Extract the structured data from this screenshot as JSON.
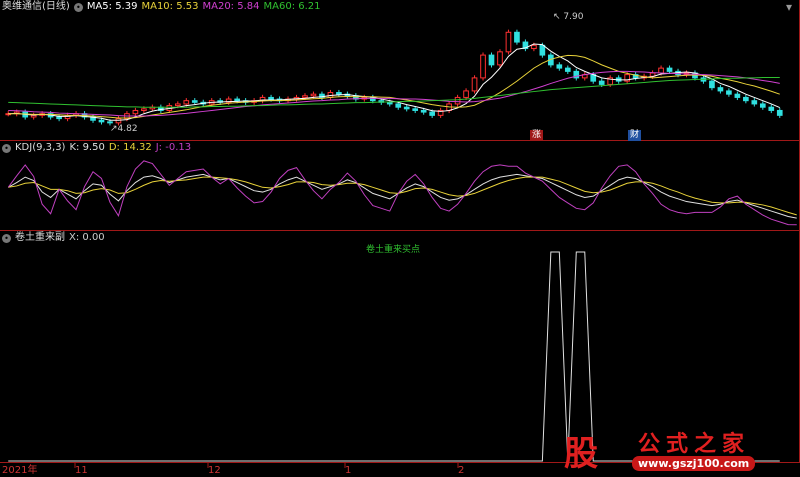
{
  "panel_main": {
    "stock_name": "奥维通信(日线)",
    "ma": [
      {
        "label": "MA5: 5.39",
        "color": "#ffffff"
      },
      {
        "label": "MA10: 5.53",
        "color": "#e8d23a"
      },
      {
        "label": "MA20: 5.84",
        "color": "#d040d0"
      },
      {
        "label": "MA60: 6.21",
        "color": "#30c030"
      }
    ],
    "high_label": "7.90",
    "low_label": "4.82",
    "stamp_up": "涨",
    "stamp_fin": "财"
  },
  "panel_kdj": {
    "name": "KDJ(9,3,3)",
    "k": "K: 9.50",
    "d": "D: 14.32",
    "j": "J: -0.13",
    "colors": {
      "k": "#e0e0e0",
      "d": "#e8d23a",
      "j": "#c040c0"
    }
  },
  "panel_ind": {
    "name": "卷土重来副",
    "x": "X: 0.00",
    "signal_label": "卷土重来买点",
    "colors": {
      "line": "#e0e0e0",
      "signal": "#30c030"
    }
  },
  "x_axis": [
    "2021年",
    "11",
    "12",
    "1",
    "2"
  ],
  "logo": {
    "gu": "股",
    "name": "公式之家",
    "url": "www.gszj100.com"
  },
  "chart_data": [
    {
      "type": "candlestick",
      "title": "奥维通信(日线)",
      "x": [
        "2021年",
        "11",
        "12",
        "1",
        "2"
      ],
      "close": [
        5.1,
        5.15,
        5.0,
        5.05,
        5.1,
        5.0,
        4.95,
        5.05,
        5.1,
        5.0,
        4.9,
        4.85,
        4.82,
        4.95,
        5.1,
        5.2,
        5.25,
        5.3,
        5.2,
        5.35,
        5.4,
        5.5,
        5.45,
        5.4,
        5.5,
        5.45,
        5.55,
        5.5,
        5.45,
        5.5,
        5.6,
        5.55,
        5.5,
        5.55,
        5.6,
        5.65,
        5.7,
        5.6,
        5.75,
        5.7,
        5.65,
        5.55,
        5.6,
        5.5,
        5.45,
        5.4,
        5.3,
        5.25,
        5.2,
        5.15,
        5.05,
        5.2,
        5.4,
        5.6,
        5.8,
        6.2,
        6.9,
        6.6,
        7.0,
        7.6,
        7.3,
        7.1,
        7.2,
        6.9,
        6.6,
        6.5,
        6.4,
        6.2,
        6.3,
        6.1,
        6.0,
        6.2,
        6.1,
        6.3,
        6.2,
        6.25,
        6.35,
        6.5,
        6.4,
        6.3,
        6.35,
        6.2,
        6.1,
        5.9,
        5.8,
        5.7,
        5.6,
        5.5,
        5.4,
        5.3,
        5.2,
        5.05
      ],
      "high_marker": 7.9,
      "low_marker": 4.82,
      "series": [
        {
          "name": "MA5",
          "values": [
            5.1,
            5.11,
            5.08,
            5.06,
            5.08,
            5.06,
            5.02,
            5.02,
            5.04,
            5.02,
            4.99,
            4.96,
            4.9,
            4.9,
            4.92,
            5.0,
            5.1,
            5.18,
            5.23,
            5.26,
            5.3,
            5.35,
            5.38,
            5.42,
            5.45,
            5.46,
            5.47,
            5.48,
            5.49,
            5.49,
            5.52,
            5.52,
            5.52,
            5.54,
            5.56,
            5.57,
            5.6,
            5.62,
            5.66,
            5.68,
            5.69,
            5.65,
            5.63,
            5.6,
            5.55,
            5.5,
            5.45,
            5.38,
            5.32,
            5.26,
            5.19,
            5.17,
            5.2,
            5.28,
            5.41,
            5.64,
            6.0,
            6.22,
            6.5,
            6.86,
            7.08,
            7.12,
            7.24,
            7.22,
            7.02,
            6.86,
            6.72,
            6.52,
            6.4,
            6.3,
            6.2,
            6.16,
            6.14,
            6.14,
            6.18,
            6.21,
            6.24,
            6.32,
            6.34,
            6.36,
            6.38,
            6.35,
            6.27,
            6.17,
            6.03,
            5.94,
            5.82,
            5.7,
            5.6,
            5.5,
            5.4,
            5.29
          ]
        },
        {
          "name": "MA10",
          "values": [
            5.1,
            5.1,
            5.09,
            5.08,
            5.08,
            5.08,
            5.07,
            5.05,
            5.05,
            5.04,
            5.03,
            5.01,
            4.99,
            4.97,
            4.97,
            4.98,
            5.02,
            5.06,
            5.1,
            5.14,
            5.18,
            5.22,
            5.27,
            5.32,
            5.36,
            5.39,
            5.42,
            5.44,
            5.46,
            5.47,
            5.49,
            5.5,
            5.5,
            5.51,
            5.52,
            5.54,
            5.56,
            5.57,
            5.6,
            5.62,
            5.63,
            5.62,
            5.62,
            5.62,
            5.61,
            5.6,
            5.56,
            5.52,
            5.48,
            5.43,
            5.38,
            5.34,
            5.31,
            5.3,
            5.31,
            5.36,
            5.48,
            5.6,
            5.75,
            5.92,
            6.1,
            6.3,
            6.5,
            6.65,
            6.77,
            6.84,
            6.89,
            6.88,
            6.83,
            6.72,
            6.6,
            6.5,
            6.4,
            6.34,
            6.28,
            6.23,
            6.2,
            6.22,
            6.24,
            6.26,
            6.28,
            6.29,
            6.28,
            6.25,
            6.19,
            6.14,
            6.08,
            6.01,
            5.95,
            5.87,
            5.79,
            5.7
          ]
        },
        {
          "name": "MA20",
          "values": [
            5.2,
            5.19,
            5.18,
            5.16,
            5.15,
            5.14,
            5.12,
            5.11,
            5.1,
            5.09,
            5.08,
            5.07,
            5.06,
            5.04,
            5.03,
            5.03,
            5.03,
            5.04,
            5.05,
            5.07,
            5.09,
            5.11,
            5.14,
            5.17,
            5.2,
            5.23,
            5.26,
            5.29,
            5.32,
            5.34,
            5.37,
            5.39,
            5.41,
            5.43,
            5.45,
            5.47,
            5.49,
            5.5,
            5.52,
            5.53,
            5.55,
            5.56,
            5.57,
            5.57,
            5.57,
            5.57,
            5.56,
            5.55,
            5.55,
            5.54,
            5.52,
            5.5,
            5.48,
            5.47,
            5.46,
            5.47,
            5.5,
            5.54,
            5.58,
            5.64,
            5.71,
            5.78,
            5.86,
            5.94,
            6.03,
            6.11,
            6.19,
            6.25,
            6.3,
            6.34,
            6.37,
            6.39,
            6.4,
            6.4,
            6.39,
            6.38,
            6.36,
            6.35,
            6.34,
            6.33,
            6.32,
            6.31,
            6.3,
            6.29,
            6.27,
            6.25,
            6.23,
            6.2,
            6.16,
            6.12,
            6.08,
            6.03
          ]
        },
        {
          "name": "MA60",
          "values": [
            5.45,
            5.44,
            5.43,
            5.42,
            5.41,
            5.4,
            5.39,
            5.38,
            5.37,
            5.36,
            5.35,
            5.34,
            5.33,
            5.32,
            5.31,
            5.31,
            5.3,
            5.3,
            5.3,
            5.3,
            5.3,
            5.3,
            5.31,
            5.31,
            5.32,
            5.32,
            5.33,
            5.33,
            5.34,
            5.35,
            5.35,
            5.36,
            5.37,
            5.37,
            5.38,
            5.39,
            5.4,
            5.4,
            5.41,
            5.42,
            5.43,
            5.44,
            5.44,
            5.45,
            5.46,
            5.46,
            5.47,
            5.48,
            5.48,
            5.49,
            5.5,
            5.51,
            5.52,
            5.53,
            5.55,
            5.57,
            5.6,
            5.63,
            5.66,
            5.69,
            5.72,
            5.75,
            5.78,
            5.81,
            5.84,
            5.86,
            5.88,
            5.9,
            5.92,
            5.94,
            5.96,
            5.98,
            6.0,
            6.02,
            6.04,
            6.06,
            6.08,
            6.1,
            6.12,
            6.13,
            6.14,
            6.15,
            6.16,
            6.17,
            6.18,
            6.19,
            6.19,
            6.2,
            6.2,
            6.21,
            6.21,
            6.21
          ]
        }
      ],
      "ylim": [
        4.6,
        8.1
      ]
    },
    {
      "type": "line",
      "title": "KDJ(9,3,3)",
      "series": [
        {
          "name": "K",
          "values": [
            55,
            62,
            70,
            65,
            48,
            40,
            52,
            45,
            38,
            50,
            60,
            58,
            45,
            35,
            50,
            62,
            70,
            72,
            68,
            62,
            66,
            70,
            72,
            74,
            70,
            66,
            68,
            62,
            56,
            50,
            48,
            52,
            60,
            66,
            70,
            64,
            58,
            52,
            56,
            60,
            66,
            62,
            54,
            46,
            42,
            38,
            46,
            54,
            60,
            56,
            48,
            40,
            36,
            38,
            44,
            52,
            60,
            66,
            70,
            72,
            74,
            72,
            70,
            68,
            62,
            56,
            50,
            44,
            40,
            42,
            50,
            58,
            66,
            70,
            68,
            62,
            56,
            48,
            42,
            38,
            34,
            32,
            30,
            28,
            30,
            34,
            36,
            32,
            28,
            24,
            20,
            16,
            12,
            9.5
          ]
        },
        {
          "name": "D",
          "values": [
            55,
            57,
            61,
            62,
            57,
            52,
            52,
            50,
            46,
            47,
            51,
            53,
            51,
            46,
            47,
            52,
            58,
            63,
            65,
            64,
            65,
            66,
            68,
            70,
            70,
            69,
            68,
            66,
            63,
            59,
            55,
            54,
            56,
            59,
            63,
            63,
            62,
            59,
            58,
            59,
            61,
            61,
            59,
            55,
            51,
            47,
            46,
            49,
            53,
            54,
            52,
            48,
            44,
            42,
            43,
            46,
            51,
            56,
            61,
            65,
            68,
            70,
            70,
            70,
            67,
            64,
            59,
            54,
            49,
            47,
            48,
            51,
            56,
            61,
            63,
            63,
            61,
            57,
            52,
            48,
            43,
            39,
            36,
            33,
            32,
            32,
            33,
            33,
            31,
            29,
            26,
            22,
            18,
            14.32
          ]
        },
        {
          "name": "J",
          "values": [
            55,
            72,
            88,
            71,
            30,
            16,
            52,
            35,
            22,
            56,
            78,
            68,
            33,
            13,
            56,
            82,
            94,
            90,
            74,
            58,
            68,
            78,
            80,
            82,
            70,
            60,
            68,
            54,
            42,
            32,
            34,
            48,
            68,
            80,
            84,
            66,
            50,
            38,
            52,
            62,
            76,
            64,
            44,
            28,
            24,
            20,
            46,
            64,
            74,
            60,
            40,
            24,
            20,
            30,
            46,
            64,
            78,
            86,
            88,
            86,
            86,
            76,
            70,
            64,
            52,
            40,
            32,
            24,
            22,
            32,
            54,
            72,
            86,
            88,
            78,
            60,
            46,
            30,
            22,
            18,
            16,
            18,
            18,
            18,
            26,
            38,
            42,
            30,
            22,
            14,
            8,
            4,
            0,
            -0.13
          ]
        }
      ],
      "ylim": [
        -5,
        110
      ]
    },
    {
      "type": "line",
      "title": "卷土重来副",
      "series": [
        {
          "name": "X",
          "values": [
            0,
            0,
            0,
            0,
            0,
            0,
            0,
            0,
            0,
            0,
            0,
            0,
            0,
            0,
            0,
            0,
            0,
            0,
            0,
            0,
            0,
            0,
            0,
            0,
            0,
            0,
            0,
            0,
            0,
            0,
            0,
            0,
            0,
            0,
            0,
            0,
            0,
            0,
            0,
            0,
            0,
            0,
            0,
            0,
            0,
            0,
            0,
            0,
            0,
            0,
            0,
            0,
            0,
            0,
            0,
            0,
            0,
            0,
            0,
            0,
            0,
            0,
            0,
            0,
            1,
            1,
            0,
            1,
            1,
            0,
            0,
            0,
            0,
            0,
            0,
            0,
            0,
            0,
            0,
            0,
            0,
            0,
            0,
            0,
            0,
            0,
            0,
            0,
            0,
            0,
            0,
            0
          ]
        }
      ],
      "ylim": [
        0,
        1
      ]
    }
  ]
}
